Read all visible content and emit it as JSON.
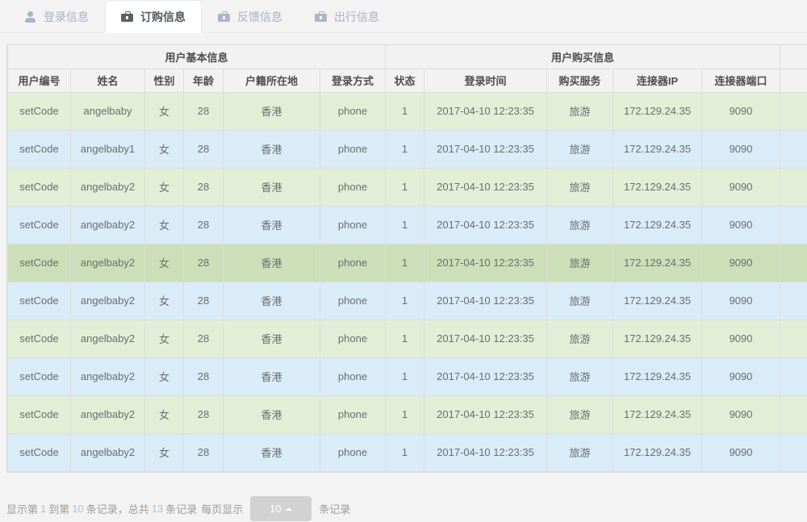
{
  "tabs": [
    {
      "label": "登录信息",
      "icon": "user-icon",
      "active": false
    },
    {
      "label": "订购信息",
      "icon": "briefcase-icon",
      "active": true
    },
    {
      "label": "反馈信息",
      "icon": "briefcase-icon",
      "active": false
    },
    {
      "label": "出行信息",
      "icon": "briefcase-icon",
      "active": false
    }
  ],
  "table": {
    "group_headers": [
      {
        "label": "用户基本信息",
        "colspan": 6
      },
      {
        "label": "用户购买信息",
        "colspan": 5
      },
      {
        "label": "",
        "colspan": 1
      }
    ],
    "columns": [
      "用户编号",
      "姓名",
      "性别",
      "年龄",
      "户籍所在地",
      "登录方式",
      "状态",
      "登录时间",
      "购买服务",
      "连接器IP",
      "连接器端口",
      ""
    ],
    "rows": [
      {
        "code": "setCode",
        "name": "angelbaby",
        "gender": "女",
        "age": "28",
        "origin": "香港",
        "login_type": "phone",
        "status": "1",
        "login_time": "2017-04-10 12:23:35",
        "service": "旅游",
        "ip": "172.129.24.35",
        "port": "9090",
        "style": "green"
      },
      {
        "code": "setCode",
        "name": "angelbaby1",
        "gender": "女",
        "age": "28",
        "origin": "香港",
        "login_type": "phone",
        "status": "1",
        "login_time": "2017-04-10 12:23:35",
        "service": "旅游",
        "ip": "172.129.24.35",
        "port": "9090",
        "style": "blue"
      },
      {
        "code": "setCode",
        "name": "angelbaby2",
        "gender": "女",
        "age": "28",
        "origin": "香港",
        "login_type": "phone",
        "status": "1",
        "login_time": "2017-04-10 12:23:35",
        "service": "旅游",
        "ip": "172.129.24.35",
        "port": "9090",
        "style": "green"
      },
      {
        "code": "setCode",
        "name": "angelbaby2",
        "gender": "女",
        "age": "28",
        "origin": "香港",
        "login_type": "phone",
        "status": "1",
        "login_time": "2017-04-10 12:23:35",
        "service": "旅游",
        "ip": "172.129.24.35",
        "port": "9090",
        "style": "blue"
      },
      {
        "code": "setCode",
        "name": "angelbaby2",
        "gender": "女",
        "age": "28",
        "origin": "香港",
        "login_type": "phone",
        "status": "1",
        "login_time": "2017-04-10 12:23:35",
        "service": "旅游",
        "ip": "172.129.24.35",
        "port": "9090",
        "style": "hover"
      },
      {
        "code": "setCode",
        "name": "angelbaby2",
        "gender": "女",
        "age": "28",
        "origin": "香港",
        "login_type": "phone",
        "status": "1",
        "login_time": "2017-04-10 12:23:35",
        "service": "旅游",
        "ip": "172.129.24.35",
        "port": "9090",
        "style": "blue"
      },
      {
        "code": "setCode",
        "name": "angelbaby2",
        "gender": "女",
        "age": "28",
        "origin": "香港",
        "login_type": "phone",
        "status": "1",
        "login_time": "2017-04-10 12:23:35",
        "service": "旅游",
        "ip": "172.129.24.35",
        "port": "9090",
        "style": "green"
      },
      {
        "code": "setCode",
        "name": "angelbaby2",
        "gender": "女",
        "age": "28",
        "origin": "香港",
        "login_type": "phone",
        "status": "1",
        "login_time": "2017-04-10 12:23:35",
        "service": "旅游",
        "ip": "172.129.24.35",
        "port": "9090",
        "style": "blue"
      },
      {
        "code": "setCode",
        "name": "angelbaby2",
        "gender": "女",
        "age": "28",
        "origin": "香港",
        "login_type": "phone",
        "status": "1",
        "login_time": "2017-04-10 12:23:35",
        "service": "旅游",
        "ip": "172.129.24.35",
        "port": "9090",
        "style": "green"
      },
      {
        "code": "setCode",
        "name": "angelbaby2",
        "gender": "女",
        "age": "28",
        "origin": "香港",
        "login_type": "phone",
        "status": "1",
        "login_time": "2017-04-10 12:23:35",
        "service": "旅游",
        "ip": "172.129.24.35",
        "port": "9090",
        "style": "blue"
      }
    ]
  },
  "footer": {
    "prefix": "显示第",
    "from": "1",
    "mid1": "到第",
    "to": "10",
    "mid2": "条记录，总共",
    "total": "13",
    "mid3": "条记录",
    "per_page_label": "每页显示",
    "page_size": "10",
    "suffix": "条记录"
  },
  "colors": {
    "accent_teal": "#23c6c8",
    "row_green": "#e3eed7",
    "row_blue": "#d9ecf7",
    "row_hover": "#ccdfb8",
    "header_bg": "#f2f2f2",
    "border": "#dddddd",
    "page_bg": "#f3f3f4"
  }
}
